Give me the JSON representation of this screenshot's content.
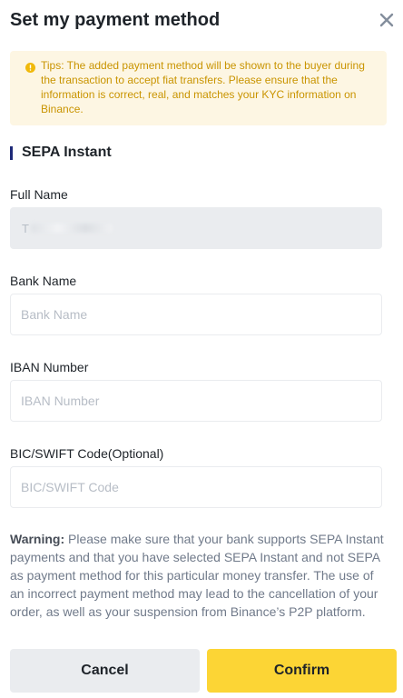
{
  "dialog": {
    "title": "Set my payment method"
  },
  "tips": {
    "text": "Tips: The added payment method will be shown to the buyer during the transaction to accept fiat transfers. Please ensure that the information is correct, real, and matches your KYC information on Binance."
  },
  "section": {
    "title": "SEPA Instant"
  },
  "fields": {
    "full_name": {
      "label": "Full Name",
      "value_visible_initial": "T"
    },
    "bank_name": {
      "label": "Bank Name",
      "placeholder": "Bank Name"
    },
    "iban": {
      "label": "IBAN Number",
      "placeholder": "IBAN Number"
    },
    "bic": {
      "label": "BIC/SWIFT Code(Optional)",
      "placeholder": "BIC/SWIFT Code"
    }
  },
  "warning": {
    "prefix": "Warning:",
    "text": " Please make sure that your bank supports SEPA Instant payments and that you have selected SEPA Instant and not SEPA as payment method for this particular money transfer. The use of an incorrect payment method may lead to the cancellation of your order, as well as your suspension from Binance’s P2P platform."
  },
  "buttons": {
    "cancel": "Cancel",
    "confirm": "Confirm"
  },
  "icons": {
    "close": "close-icon",
    "tips": "warning-circle-icon"
  },
  "colors": {
    "tips_bg": "#fdf6e3",
    "tips_text": "#c99400",
    "accent_bar": "#1e2a78",
    "confirm_bg": "#fcd535",
    "cancel_bg": "#eaecef"
  }
}
